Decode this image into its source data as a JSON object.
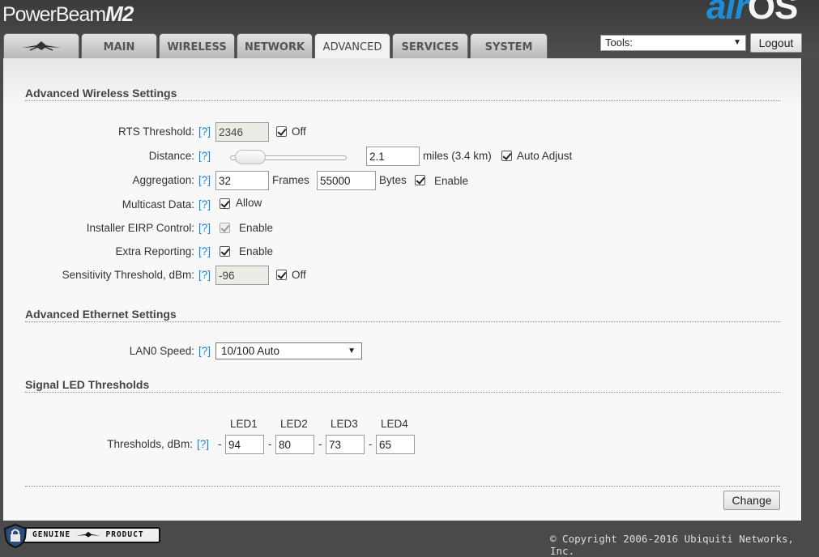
{
  "header": {
    "product_name": "PowerBeam",
    "product_model": "M2",
    "brand_air": "air",
    "brand_os": "OS"
  },
  "tabs": [
    {
      "label": "",
      "icon": "ubiquiti-logo-icon"
    },
    {
      "label": "MAIN"
    },
    {
      "label": "WIRELESS"
    },
    {
      "label": "NETWORK"
    },
    {
      "label": "ADVANCED",
      "active": true
    },
    {
      "label": "SERVICES"
    },
    {
      "label": "SYSTEM"
    }
  ],
  "toolbar": {
    "tools_value": "Tools:",
    "logout_label": "Logout"
  },
  "help": "[?]",
  "advanced_wireless": {
    "title": "Advanced Wireless Settings",
    "rts": {
      "label": "RTS Threshold:",
      "value": "2346",
      "checkbox_label": "Off",
      "checked": true
    },
    "distance": {
      "label": "Distance:",
      "value": "2.1",
      "unit_text": "miles (3.4 km)",
      "checkbox_label": "Auto Adjust",
      "checked": true,
      "slider_position": 0.05
    },
    "aggregation": {
      "label": "Aggregation:",
      "frames_value": "32",
      "frames_label": "Frames",
      "bytes_value": "55000",
      "bytes_label": "Bytes",
      "checkbox_label": "Enable",
      "checked": true
    },
    "multicast": {
      "label": "Multicast Data:",
      "checkbox_label": "Allow",
      "checked": true
    },
    "eirp": {
      "label": "Installer EIRP Control:",
      "checkbox_label": "Enable",
      "checked": true,
      "disabled": true
    },
    "extra_reporting": {
      "label": "Extra Reporting:",
      "checkbox_label": "Enable",
      "checked": true
    },
    "sensitivity": {
      "label": "Sensitivity Threshold, dBm:",
      "value": "-96",
      "checkbox_label": "Off",
      "checked": true
    }
  },
  "advanced_ethernet": {
    "title": "Advanced Ethernet Settings",
    "lan0": {
      "label": "LAN0 Speed:",
      "value": "10/100 Auto"
    }
  },
  "signal_led": {
    "title": "Signal LED Thresholds",
    "label": "Thresholds, dBm:",
    "dash": "-",
    "leds": [
      {
        "name": "LED1",
        "value": "94"
      },
      {
        "name": "LED2",
        "value": "80"
      },
      {
        "name": "LED3",
        "value": "73"
      },
      {
        "name": "LED4",
        "value": "65"
      }
    ]
  },
  "actions": {
    "change_label": "Change"
  },
  "footer": {
    "badge_text": "GENUINE",
    "badge_text2": "PRODUCT",
    "copyright": "© Copyright 2006-2016 Ubiquiti Networks, Inc."
  }
}
